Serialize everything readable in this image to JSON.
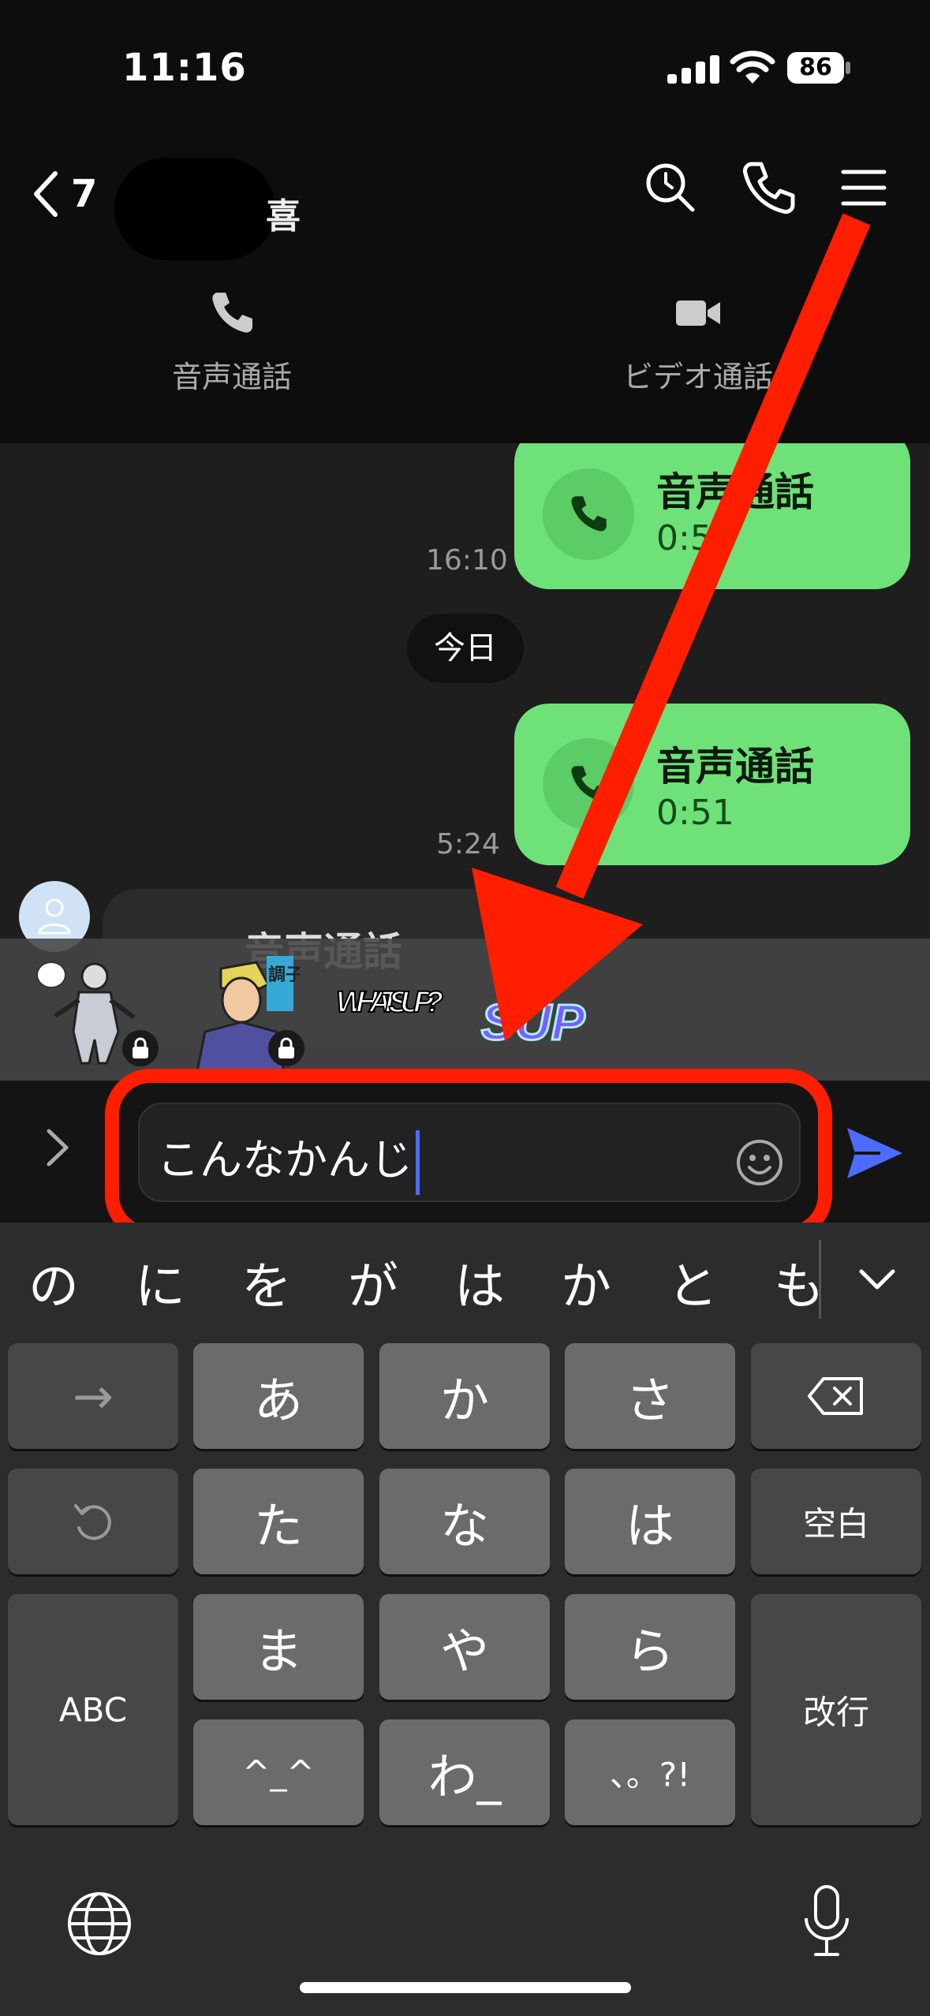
{
  "status_bar": {
    "time": "11:16",
    "battery": "86"
  },
  "header": {
    "back_count": "7",
    "name_tail": "喜",
    "icons": [
      "search-icon",
      "phone-icon",
      "menu-icon"
    ],
    "voice_call_label": "音声通話",
    "video_call_label": "ビデオ通話"
  },
  "messages": [
    {
      "type": "outgoing_call",
      "title": "音声通話",
      "duration": "0:50",
      "time": "16:10"
    },
    {
      "type": "date_separator",
      "text": "今日"
    },
    {
      "type": "outgoing_call",
      "title": "音声通話",
      "duration": "0:51",
      "time": "5:24"
    },
    {
      "type": "incoming_call",
      "title": "音声通話"
    }
  ],
  "sticker_tray": {
    "stickers": [
      "sticker-warrior",
      "sticker-man-調子",
      "sticker-whats-up",
      "sticker-sup"
    ],
    "labels": {
      "choshi": "調子",
      "whats_up": "WHAT'S UP?",
      "sup": "SUP"
    }
  },
  "input": {
    "value": "こんなかんじ",
    "icons": [
      "expand-icon",
      "emoji-icon",
      "send-icon"
    ]
  },
  "keyboard": {
    "suggestions": [
      "の",
      "に",
      "を",
      "が",
      "は",
      "か",
      "と",
      "も"
    ],
    "rows": {
      "r1": [
        "→",
        "あ",
        "か",
        "さ",
        "delete"
      ],
      "r2": [
        "undo",
        "た",
        "な",
        "は",
        "空白"
      ],
      "r3": [
        "ABC",
        "ま",
        "や",
        "ら",
        "改行"
      ],
      "r4": [
        "^_^",
        "わ_",
        "、。?!"
      ]
    },
    "labels": {
      "arrow": "→",
      "a": "あ",
      "ka": "か",
      "sa": "さ",
      "ta": "た",
      "na": "な",
      "ha": "は",
      "space": "空白",
      "abc": "ABC",
      "ma": "ま",
      "ya": "や",
      "ra": "ら",
      "enter": "改行",
      "kaomoji": "^_^",
      "wa": "わ_",
      "punct": "、。?!"
    }
  },
  "colors": {
    "bubble_out": "#6ee278",
    "annotation": "#ff1e00",
    "send": "#4b6cff",
    "bg": "#1e1e1e"
  }
}
